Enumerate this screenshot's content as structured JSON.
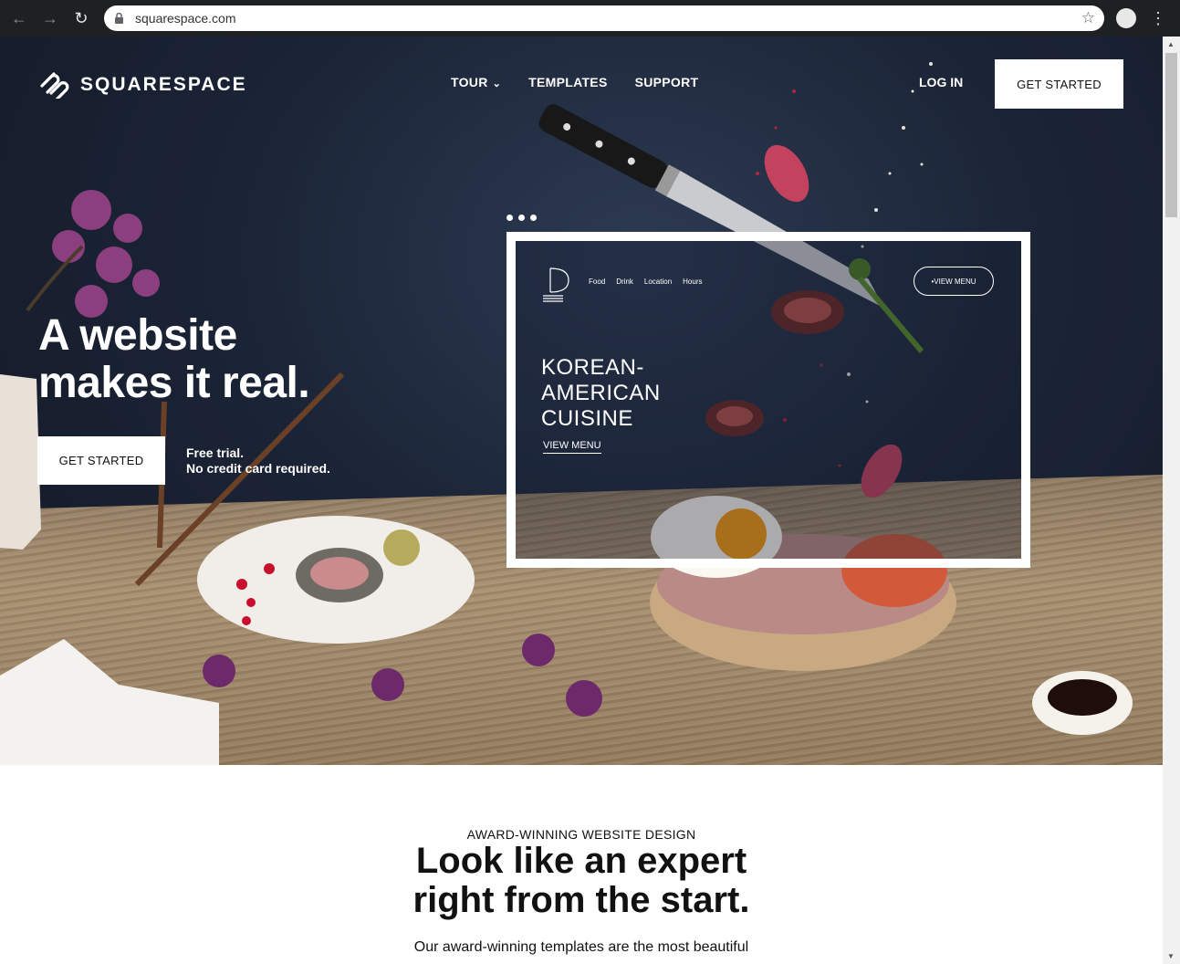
{
  "browser": {
    "url": "squarespace.com",
    "icons": [
      "back-icon",
      "forward-icon",
      "reload-icon",
      "lock-icon",
      "star-icon",
      "profile-icon",
      "menu-icon"
    ]
  },
  "header": {
    "brand": "SQUARESPACE",
    "nav": [
      {
        "label": "TOUR"
      },
      {
        "label": "TEMPLATES"
      },
      {
        "label": "SUPPORT"
      }
    ],
    "login": "LOG IN",
    "cta": "GET STARTED"
  },
  "hero": {
    "headline_line1": "A website",
    "headline_line2": "makes it real.",
    "cta": "GET STARTED",
    "trial_line1": "Free trial.",
    "trial_line2": "No credit card required."
  },
  "preview": {
    "nav": [
      "Food",
      "Drink",
      "Location",
      "Hours"
    ],
    "cta": "VIEW MENU",
    "title_line1": "KOREAN-",
    "title_line2": "AMERICAN",
    "title_line3": "CUISINE",
    "link": "VIEW MENU"
  },
  "section": {
    "eyebrow": "AWARD-WINNING WEBSITE DESIGN",
    "title_line1": "Look like an expert",
    "title_line2": "right from the start.",
    "body_line1": "Our award-winning templates are the most beautiful"
  },
  "colors": {
    "hero_bg": "#1b2436",
    "table": "#a88f6f",
    "chrome": "#1f2022"
  }
}
